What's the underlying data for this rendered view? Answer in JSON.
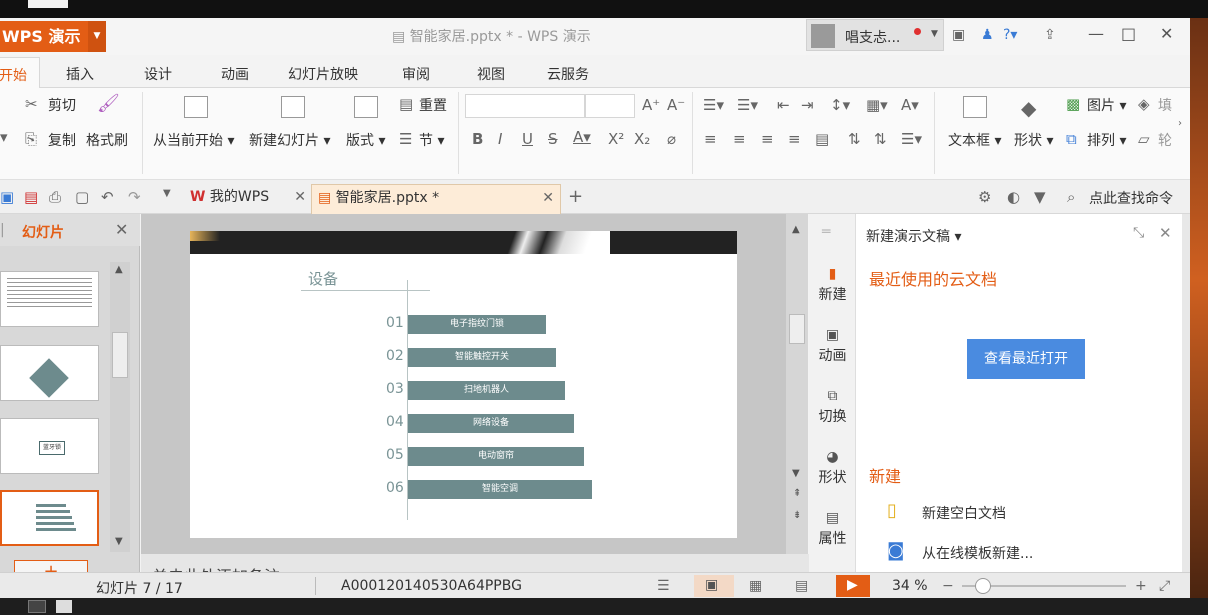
{
  "window": {
    "app_button": "WPS 演示",
    "doc_title": "智能家居.pptx * - WPS 演示",
    "user_name": "唱支忐...",
    "accent": "#e35d15"
  },
  "menu": {
    "items": [
      "开始",
      "插入",
      "设计",
      "动画",
      "幻灯片放映",
      "审阅",
      "视图",
      "云服务"
    ]
  },
  "ribbon": {
    "cut": "剪切",
    "copy": "复制",
    "format_painter": "格式刷",
    "from_current": "从当前开始",
    "new_slide": "新建幻灯片",
    "layout": "版式",
    "reset": "重置",
    "section": "节",
    "textbox": "文本框",
    "shape": "形状",
    "arrange": "排列",
    "picture": "图片",
    "fill": "填",
    "outline": "轮"
  },
  "tabs": {
    "my_wps": "我的WPS",
    "doc": "智能家居.pptx *",
    "search": "点此查找命令"
  },
  "left_panel": {
    "tab_label": "幻灯片",
    "thumb3_label": "蓝牙锁",
    "add_button": "+"
  },
  "slide": {
    "heading": "设备",
    "items": [
      {
        "num": "01",
        "label": "电子指纹门锁"
      },
      {
        "num": "02",
        "label": "智能触控开关"
      },
      {
        "num": "03",
        "label": "扫地机器人"
      },
      {
        "num": "04",
        "label": "网络设备"
      },
      {
        "num": "05",
        "label": "电动窗帘"
      },
      {
        "num": "06",
        "label": "智能空调"
      }
    ]
  },
  "notes": {
    "placeholder": "单击此处添加备注"
  },
  "task_pane": {
    "title": "新建演示文稿",
    "side_items": [
      "新建",
      "动画",
      "切换",
      "形状",
      "属性"
    ],
    "recent_heading": "最近使用的云文档",
    "recent_button": "查看最近打开",
    "new_heading": "新建",
    "new_blank": "新建空白文档",
    "new_online": "从在线模板新建..."
  },
  "status": {
    "slide_info": "幻灯片 7 / 17",
    "doc_id": "A000120140530A64PPBG",
    "zoom": "34 %"
  }
}
